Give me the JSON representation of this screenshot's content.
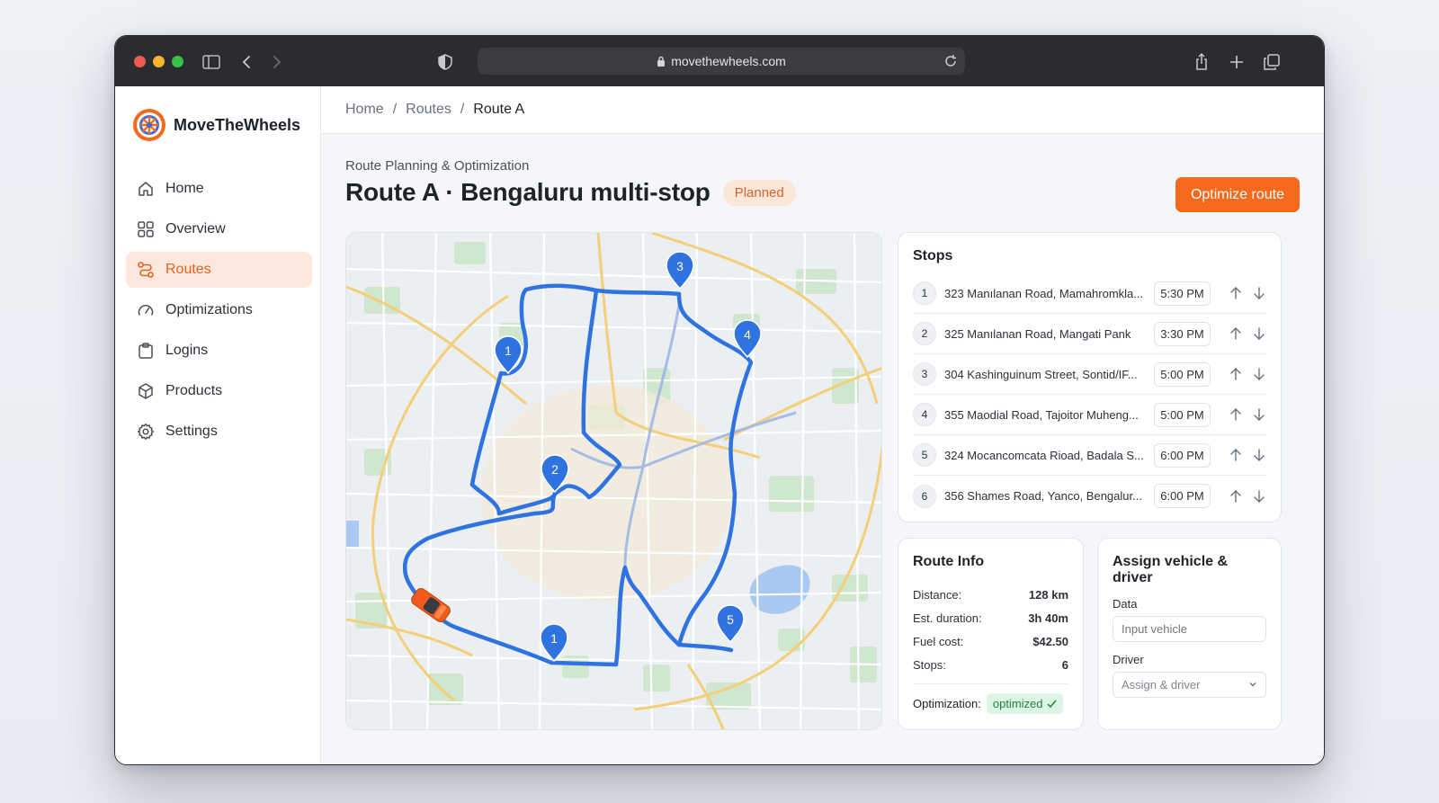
{
  "browser": {
    "url": "movethewheels.com",
    "traffic_lights": [
      "#ee5b52",
      "#f5b52d",
      "#37c249"
    ]
  },
  "brand": {
    "name": "MoveTheWheels",
    "accent": "#f56a1c"
  },
  "sidebar": {
    "items": [
      {
        "label": "Home",
        "icon": "home-icon"
      },
      {
        "label": "Overview",
        "icon": "grid-icon"
      },
      {
        "label": "Routes",
        "icon": "route-icon",
        "active": true
      },
      {
        "label": "Optimizations",
        "icon": "gauge-icon"
      },
      {
        "label": "Logins",
        "icon": "clipboard-icon"
      },
      {
        "label": "Products",
        "icon": "box-icon"
      },
      {
        "label": "Settings",
        "icon": "gear-icon"
      }
    ]
  },
  "breadcrumb": {
    "items": [
      "Home",
      "Routes",
      "Route A"
    ],
    "separator": "/"
  },
  "page": {
    "subtitle": "Route Planning & Optimization",
    "title": "Route A · Bengaluru multi-stop",
    "status": "Planned",
    "optimize_label": "Optimize route"
  },
  "stops": {
    "heading": "Stops",
    "rows": [
      {
        "num": "1",
        "address": "323 Manılanan Road, Mamahromkla...",
        "time": "5:30 PM"
      },
      {
        "num": "2",
        "address": "325 Manılanan Road, Mangati Pank",
        "time": "3:30 PM"
      },
      {
        "num": "3",
        "address": "304 Kashinguinum Street, Sontid/IF...",
        "time": "5:00 PM"
      },
      {
        "num": "4",
        "address": "355 Maodial Road, Tajoitor Muheng...",
        "time": "5:00 PM"
      },
      {
        "num": "5",
        "address": "324 Mocancomcata Rioad, Badala S...",
        "time": "6:00 PM"
      },
      {
        "num": "6",
        "address": "356 Shames Road, Yanco, Bengalur...",
        "time": "6:00 PM"
      }
    ]
  },
  "route_info": {
    "heading": "Route Info",
    "rows": [
      {
        "label": "Distance:",
        "value": "128 km"
      },
      {
        "label": "Est. duration:",
        "value": "3h 40m"
      },
      {
        "label": "Fuel cost:",
        "value": "$42.50"
      },
      {
        "label": "Stops:",
        "value": "6"
      }
    ],
    "optimization_label": "Optimization:",
    "optimization_status": "optimized"
  },
  "assign": {
    "heading": "Assign vehicle & driver",
    "data_label": "Data",
    "vehicle_placeholder": "Input vehicle",
    "driver_label": "Driver",
    "driver_value": "Assign & driver"
  },
  "map": {
    "markers": [
      "1",
      "2",
      "3",
      "4",
      "5",
      "1"
    ],
    "route_color": "#2f73e0",
    "vehicle_color": "#f05a1a"
  }
}
